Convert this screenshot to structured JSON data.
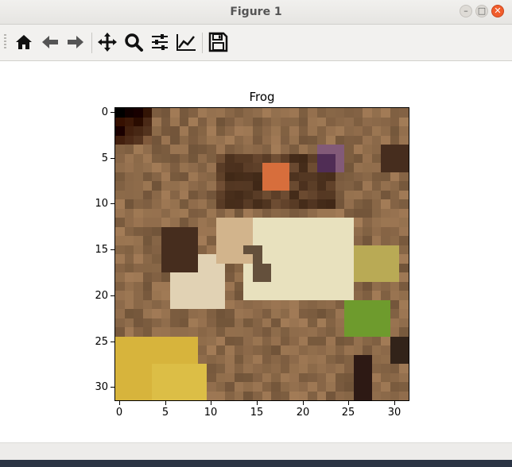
{
  "window": {
    "title": "Figure 1"
  },
  "toolbar": {
    "buttons": [
      {
        "name": "home-button",
        "icon": "home-icon"
      },
      {
        "name": "back-button",
        "icon": "arrow-left-icon"
      },
      {
        "name": "forward-button",
        "icon": "arrow-right-icon"
      },
      {
        "name": "pan-button",
        "icon": "move-icon"
      },
      {
        "name": "zoom-button",
        "icon": "magnifier-icon"
      },
      {
        "name": "configure-subplots-button",
        "icon": "sliders-icon"
      },
      {
        "name": "edit-axis-button",
        "icon": "line-chart-icon"
      },
      {
        "name": "save-button",
        "icon": "floppy-disk-icon"
      }
    ]
  },
  "figure": {
    "title": "Frog",
    "y_ticks": [
      "0",
      "5",
      "10",
      "15",
      "20",
      "25",
      "30"
    ],
    "x_ticks": [
      "0",
      "5",
      "10",
      "15",
      "20",
      "25",
      "30"
    ],
    "image_resolution": "32x32"
  },
  "colors": {
    "window_close": "#f15d2c",
    "background_brown": "#8a6a4a",
    "frog_cream": "#e8e2c0",
    "frog_orange": "#d0703a",
    "yellow": "#d8b43a",
    "green": "#6a9a2a"
  }
}
